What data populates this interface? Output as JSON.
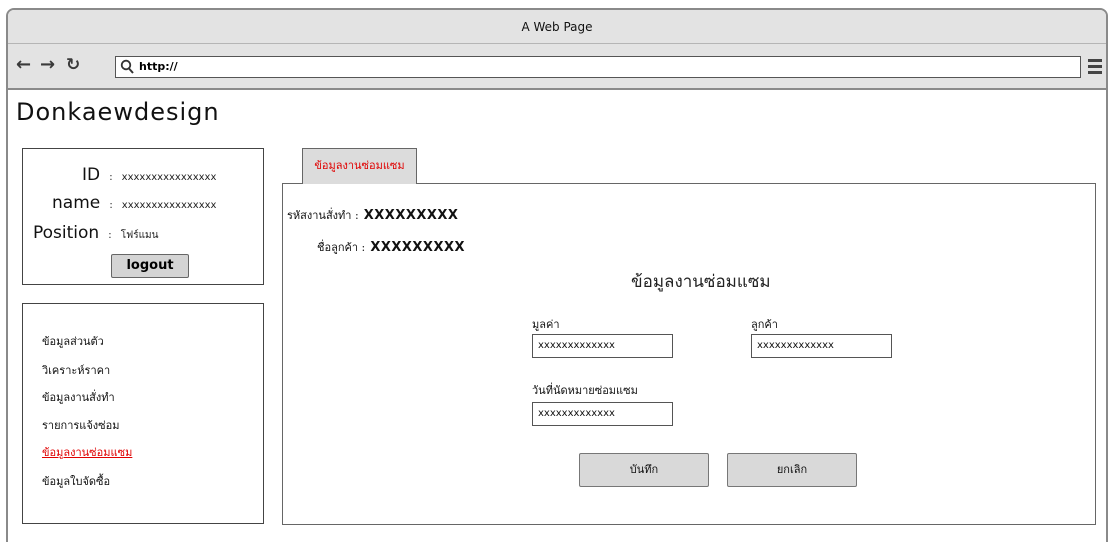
{
  "browser": {
    "title": "A Web Page",
    "url": "http://",
    "back_icon": "arrow-left",
    "forward_icon": "arrow-right",
    "reload_icon": "reload",
    "menu_icon": "hamburger"
  },
  "brand": "Donkaewdesign",
  "user": {
    "id_label": "ID",
    "id_value": "xxxxxxxxxxxxxxxx",
    "name_label": "name",
    "name_value": "xxxxxxxxxxxxxxxx",
    "position_label": "Position",
    "position_value": "โฟร์แมน",
    "separator": ":",
    "logout_label": "logout"
  },
  "menu": {
    "items": [
      {
        "label": "ข้อมูลส่วนตัว",
        "active": false
      },
      {
        "label": "วิเคราะห์ราคา",
        "active": false
      },
      {
        "label": "ข้อมูลงานสั่งทำ",
        "active": false
      },
      {
        "label": "รายการแจ้งซ่อม",
        "active": false
      },
      {
        "label": "ข้อมูลงานซ่อมแซม",
        "active": true
      },
      {
        "label": "ข้อมูลใบจัดซื้อ",
        "active": false
      }
    ]
  },
  "tab": {
    "label": "ข้อมูลงานซ่อมแซม"
  },
  "info": {
    "order_code_label": "รหัสงานสั่งทำ :",
    "order_code_value": "XXXXXXXXX",
    "customer_label": "ชื่อลูกค้า :",
    "customer_value": "XXXXXXXXX"
  },
  "form": {
    "title": "ข้อมูลงานซ่อมแซม",
    "value_label": "มูลค่า",
    "value_input": "xxxxxxxxxxxxx",
    "customer_label": "ลูกค้า",
    "customer_input": "xxxxxxxxxxxxx",
    "date_label": "วันที่นัดหมายซ่อมแซม",
    "date_input": "xxxxxxxxxxxxx",
    "save_label": "บันทึก",
    "cancel_label": "ยกเลิก"
  },
  "colors": {
    "active": "#e00000",
    "chrome": "#e3e3e3",
    "button": "#d9d9d9"
  }
}
